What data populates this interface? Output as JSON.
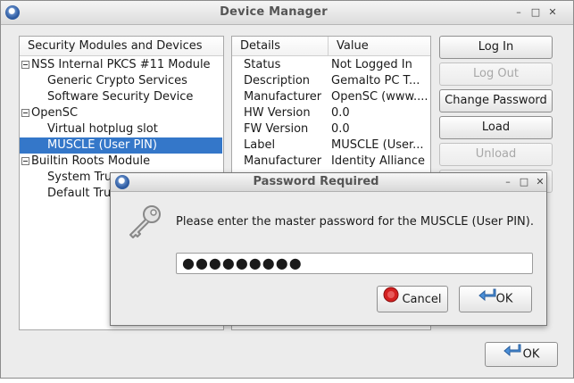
{
  "window": {
    "title": "Device Manager",
    "controls": [
      "–",
      "□",
      "✕"
    ]
  },
  "tree": {
    "header": "Security Modules and Devices",
    "items": [
      {
        "label": "NSS Internal PKCS #11 Module",
        "level": 0,
        "expander": true
      },
      {
        "label": "Generic Crypto Services",
        "level": 1
      },
      {
        "label": "Software Security Device",
        "level": 1
      },
      {
        "label": "OpenSC",
        "level": 0,
        "expander": true
      },
      {
        "label": "Virtual hotplug slot",
        "level": 1
      },
      {
        "label": "MUSCLE (User PIN)",
        "level": 1,
        "selected": true
      },
      {
        "label": "Builtin Roots Module",
        "level": 0,
        "expander": true
      },
      {
        "label": "System Tru",
        "level": 1
      },
      {
        "label": "Default Tru",
        "level": 1
      }
    ]
  },
  "details": {
    "col_details": "Details",
    "col_value": "Value",
    "rows": [
      {
        "k": "Status",
        "v": "Not Logged In"
      },
      {
        "k": "Description",
        "v": "Gemalto PC T..."
      },
      {
        "k": "Manufacturer",
        "v": "OpenSC (www...."
      },
      {
        "k": "HW Version",
        "v": "0.0"
      },
      {
        "k": "FW Version",
        "v": "0.0"
      },
      {
        "k": "Label",
        "v": "MUSCLE (User..."
      },
      {
        "k": "Manufacturer",
        "v": "Identity Alliance"
      }
    ]
  },
  "buttons": {
    "log_in": "Log In",
    "log_out": "Log Out",
    "change_password": "Change Password",
    "load": "Load",
    "unload": "Unload",
    "ok": "OK"
  },
  "dialog": {
    "title": "Password Required",
    "message": "Please enter the master password for the MUSCLE (User PIN).",
    "password_mask": "●●●●●●●●●",
    "cancel": "Cancel",
    "ok": "OK",
    "controls": [
      "–",
      "□",
      "✕"
    ]
  },
  "colors": {
    "selection": "#3477c9",
    "cancel_icon": "#d42020",
    "ok_icon": "#4a8fd8"
  },
  "icons": [
    "app-icon",
    "key-icon",
    "cancel-icon",
    "ok-arrow-icon"
  ]
}
